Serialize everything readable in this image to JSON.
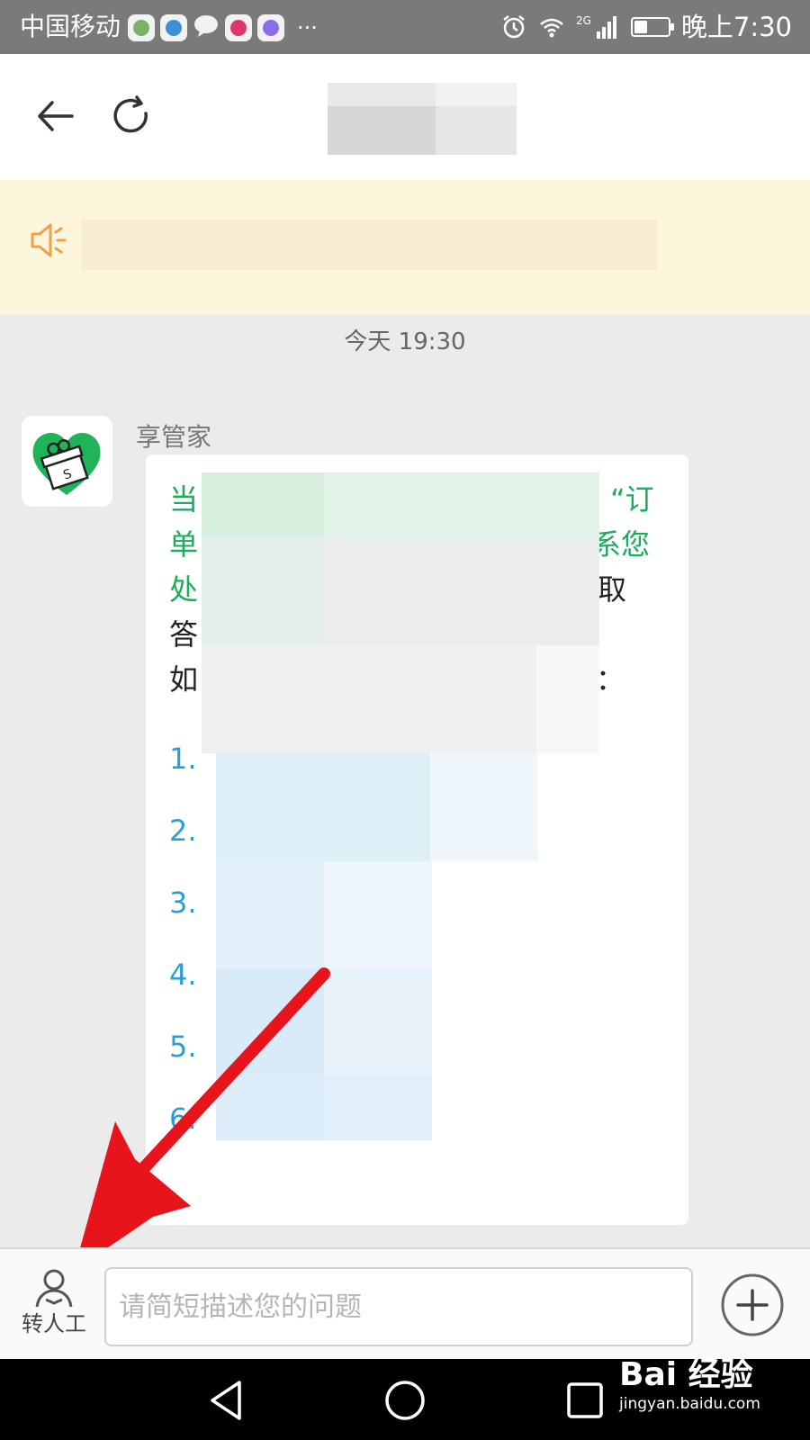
{
  "status_bar": {
    "carrier": "中国移动",
    "more": "···",
    "network": "2G",
    "time": "晚上7:30"
  },
  "notice": {
    "icon": "speaker-icon"
  },
  "chat": {
    "timestamp": "今天 19:30",
    "sender": "享管家",
    "message": {
      "line1_start": "当",
      "line1_end": "“订",
      "line2_start": "单",
      "line2_end": "系您",
      "line3_start": "处",
      "line3_end": "取",
      "line4_start": "答",
      "line5_start": "如",
      "line5_end": "：",
      "list_numbers": [
        "1.",
        "2.",
        "3.",
        "4.",
        "5.",
        "6."
      ]
    }
  },
  "input_bar": {
    "transfer_label": "转人工",
    "placeholder": "请简短描述您的问题"
  },
  "watermark": {
    "brand": "Bai 经验",
    "url": "jingyan.baidu.com"
  },
  "colors": {
    "accent_green": "#1aad5a",
    "link_blue": "#2a9fd6",
    "notice_bg": "#fef6dc",
    "arrow_red": "#e8141c"
  }
}
